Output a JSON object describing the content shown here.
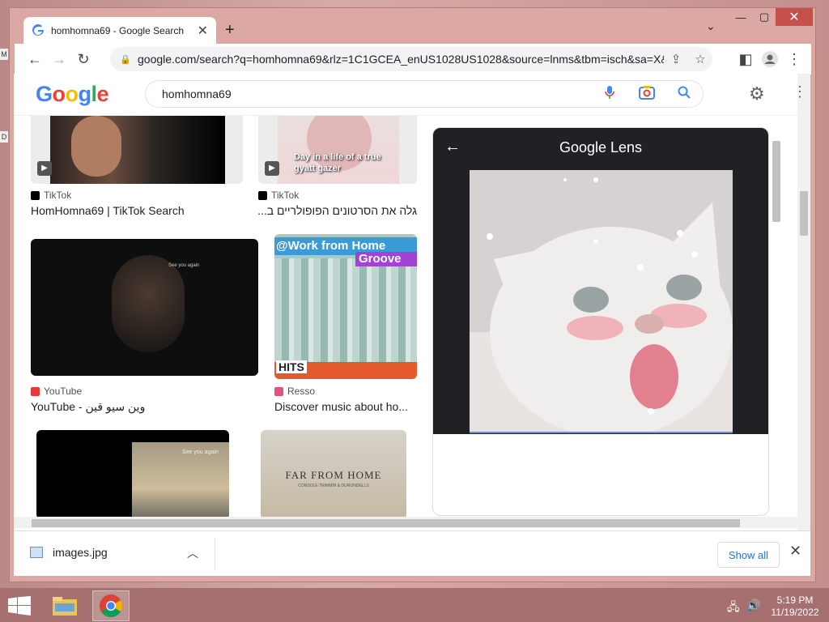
{
  "browser": {
    "tab_title": "homhomna69 - Google Search",
    "url": "google.com/search?q=homhomna69&rlz=1C1GCEA_enUS1028US1028&source=lnms&tbm=isch&sa=X&..."
  },
  "google": {
    "logo": "Google",
    "query": "homhomna69"
  },
  "results": [
    {
      "source": "TikTok",
      "caption": "HomHomna69 | TikTok Search"
    },
    {
      "source": "TikTok",
      "caption": "גלה את הסרטונים הפופולריים ב..."
    },
    {
      "source": "YouTube",
      "caption": "YouTube - وين سيو قين"
    },
    {
      "source": "Resso",
      "caption": "Discover music about ho..."
    }
  ],
  "thumb_text": {
    "day_in_life": "Day in a life of a true gyatt gazer",
    "work_from_home": "@Work from Home",
    "groove": "Groove",
    "hits": "HITS",
    "far_from_home": "FAR FROM HOME",
    "far_sub": "CONSOLE TRIMMIN & DURONDELLS",
    "see_you_again": "See you again"
  },
  "lens": {
    "title": "Google Lens"
  },
  "downloads": {
    "file": "images.jpg",
    "show_all": "Show all"
  },
  "taskbar": {
    "time": "5:19 PM",
    "date": "11/19/2022"
  },
  "colors": {
    "g_blue": "#4285F4",
    "g_red": "#EA4335",
    "g_yellow": "#FBBC05",
    "g_green": "#34A853",
    "close_red": "#c8504a",
    "lens_bg": "#202124"
  },
  "icons": [
    "google-favicon",
    "back-icon",
    "forward-icon",
    "reload-icon",
    "lock-icon",
    "share-icon",
    "star-icon",
    "sidepanel-icon",
    "profile-icon",
    "menu-icon",
    "mic-icon",
    "camera-icon",
    "search-icon",
    "gear-icon",
    "tiktok-icon",
    "youtube-icon",
    "resso-icon",
    "file-icon",
    "windows-start-icon",
    "file-explorer-icon",
    "chrome-icon",
    "network-icon",
    "volume-icon"
  ]
}
